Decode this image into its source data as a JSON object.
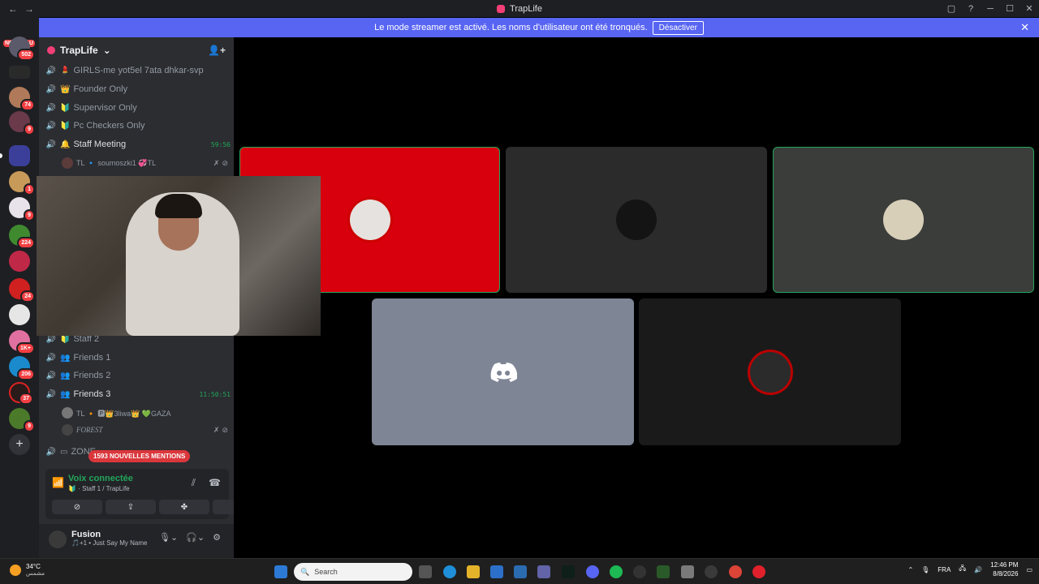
{
  "window": {
    "title": "TrapLife",
    "nav": [
      "←",
      "→"
    ],
    "controls": [
      "▢",
      "?",
      "─",
      "☐",
      "✕"
    ]
  },
  "banner": {
    "text": "Le mode streamer est activé. Les noms d'utilisateur ont été tronqués.",
    "button": "Désactiver",
    "close": "✕"
  },
  "servers": {
    "new_label": "NOUVEAU",
    "badges": [
      "502",
      "74",
      "9",
      "1",
      "9",
      "224",
      "24",
      "1K+",
      "206",
      "37",
      "9"
    ]
  },
  "sidebar": {
    "server_name": "TrapLife",
    "chevron": "⌄",
    "invite_icon": "👤+",
    "channels": [
      {
        "name": "GIRLS-me yot5el 7ata dhkar-svp",
        "emoji": "💄",
        "active": false,
        "time": ""
      },
      {
        "name": "Founder Only",
        "emoji": "👑",
        "active": false,
        "time": ""
      },
      {
        "name": "Supervisor Only",
        "emoji": "🔰",
        "active": false,
        "time": ""
      },
      {
        "name": "Pc Checkers Only",
        "emoji": "🔰",
        "active": false,
        "time": ""
      },
      {
        "name": "Staff Meeting",
        "emoji": "🔔",
        "active": true,
        "time": "59:56"
      },
      {
        "name": "Staff 2",
        "emoji": "🔰",
        "active": false,
        "time": ""
      },
      {
        "name": "Friends 1",
        "emoji": "👥",
        "active": false,
        "time": ""
      },
      {
        "name": "Friends 2",
        "emoji": "👥",
        "active": false,
        "time": ""
      },
      {
        "name": "Friends 3",
        "emoji": "👥",
        "active": true,
        "time": "11:50:51"
      },
      {
        "name": "ZONE...",
        "emoji": "▭",
        "active": false,
        "time": ""
      }
    ],
    "users": [
      {
        "name": "TL 🔹 soumoszki1 💞TL"
      },
      {
        "name": "TL 🔸 🅿👑3liwa👑 💚GAZA"
      },
      {
        "name": "FOREST"
      }
    ],
    "mentions": "1593 NOUVELLES MENTIONS"
  },
  "voice": {
    "title": "Voix connectée",
    "subtitle": "🔰 · Staff 1 / TrapLife"
  },
  "userbar": {
    "name": "Fusion",
    "status": "🎵+1 • Just Say My Name"
  },
  "tiles": {
    "colors": {
      "red": "#d9000d",
      "gray": "#2b2b2b",
      "graygreen": "#3b3d3a",
      "blurple": "#7e8595",
      "dark": "#1a1a1a",
      "speaking": "#23a55a"
    }
  },
  "taskbar": {
    "weather_temp": "34°C",
    "weather_desc": "مشمس",
    "search_placeholder": "Search",
    "lang": "FRA",
    "time": "12:46 PM",
    "date": "8/8/2026"
  }
}
